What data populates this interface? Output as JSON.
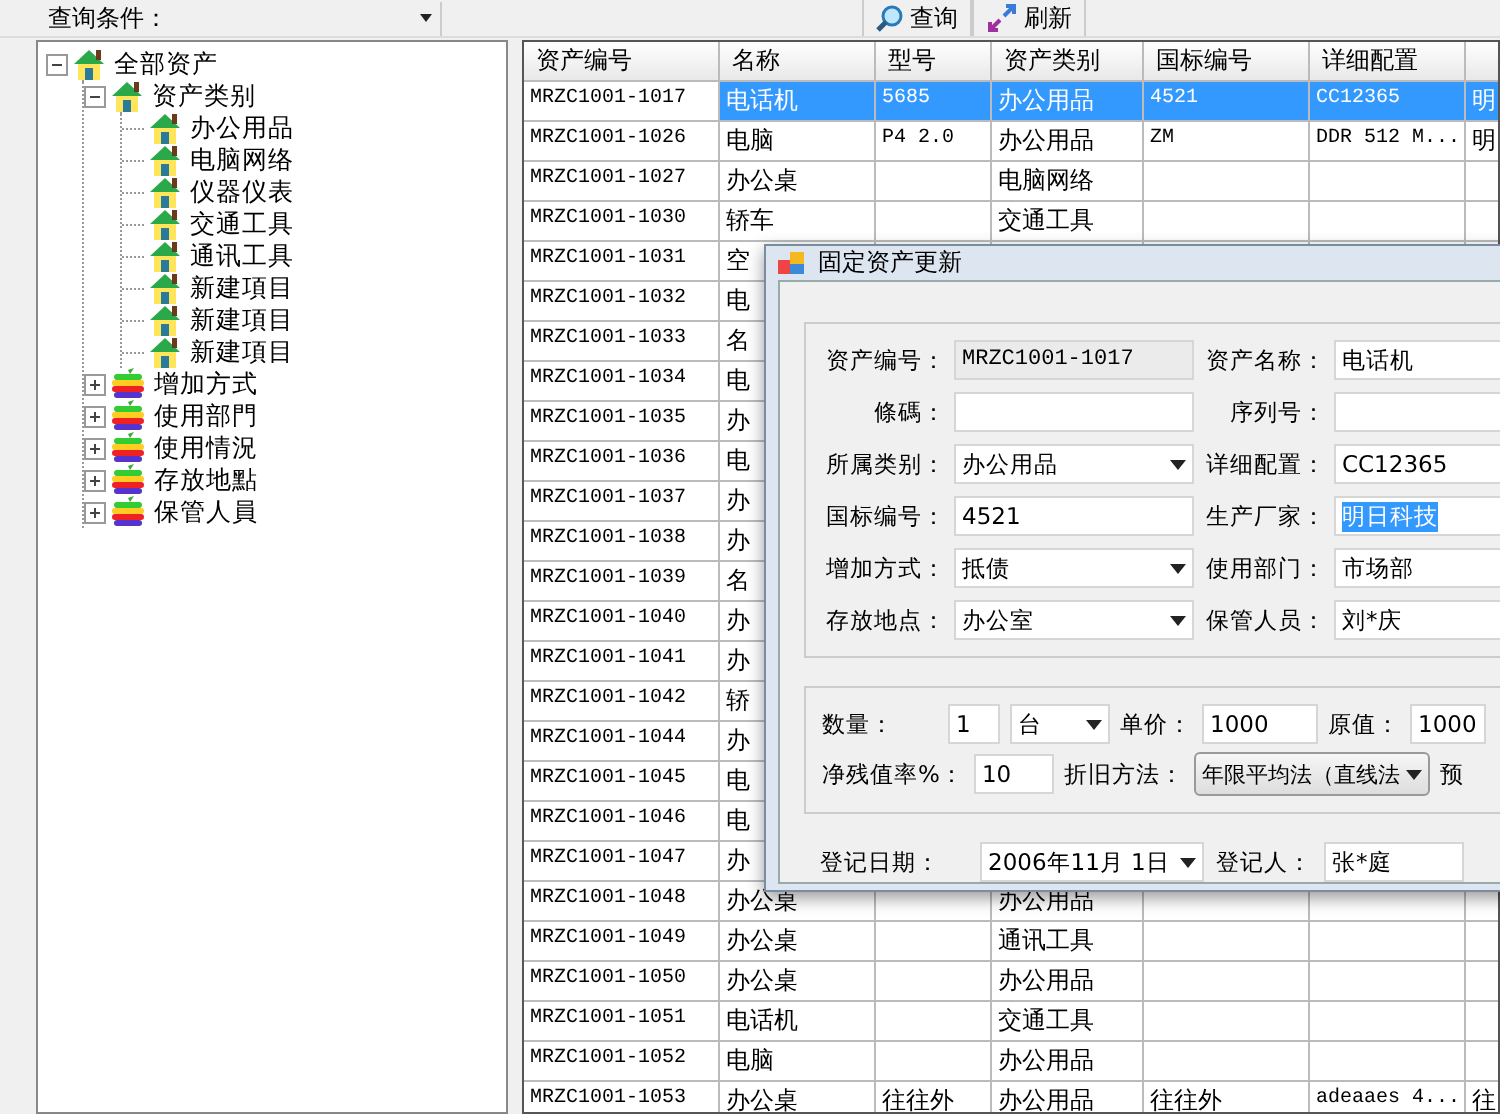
{
  "toolbar": {
    "query_label": "查询条件：",
    "buttons": [
      {
        "kind": "search",
        "label": "查询"
      },
      {
        "kind": "refresh",
        "label": "刷新"
      }
    ]
  },
  "tree": [
    {
      "label": "全部资产",
      "kind": "house",
      "expanded": true,
      "children": [
        {
          "label": "资产类别",
          "kind": "house",
          "expanded": true,
          "children": [
            {
              "label": "办公用品",
              "kind": "house"
            },
            {
              "label": "电脑网络",
              "kind": "house"
            },
            {
              "label": "仪器仪表",
              "kind": "house"
            },
            {
              "label": "交通工具",
              "kind": "house"
            },
            {
              "label": "通讯工具",
              "kind": "house"
            },
            {
              "label": "新建項目",
              "kind": "house"
            },
            {
              "label": "新建項目",
              "kind": "house"
            },
            {
              "label": "新建項目",
              "kind": "house"
            }
          ]
        },
        {
          "label": "增加方式",
          "kind": "stack",
          "expanded": false
        },
        {
          "label": "使用部門",
          "kind": "stack",
          "expanded": false
        },
        {
          "label": "使用情況",
          "kind": "stack",
          "expanded": false
        },
        {
          "label": "存放地點",
          "kind": "stack",
          "expanded": false
        },
        {
          "label": "保管人員",
          "kind": "stack",
          "expanded": false
        }
      ]
    }
  ],
  "table": {
    "columns": [
      "资产编号",
      "名称",
      "型号",
      "资产类别",
      "国标编号",
      "详细配置"
    ],
    "rows": [
      {
        "selected": true,
        "cells": [
          "MRZC1001-1017",
          "电话机",
          "5685",
          "办公用品",
          "4521",
          "CC12365",
          "明"
        ]
      },
      {
        "selected": false,
        "cells": [
          "MRZC1001-1026",
          "电脑",
          "P4 2.0",
          "办公用品",
          "ZM",
          "DDR 512 M...",
          "明"
        ]
      },
      {
        "selected": false,
        "cells": [
          "MRZC1001-1027",
          "办公桌",
          null,
          "电脑网络"
        ]
      },
      {
        "selected": false,
        "cells": [
          "MRZC1001-1030",
          "轿车",
          null,
          "交通工具"
        ]
      },
      {
        "selected": false,
        "cells": [
          "MRZC1001-1031",
          "空"
        ]
      },
      {
        "selected": false,
        "cells": [
          "MRZC1001-1032",
          "电"
        ]
      },
      {
        "selected": false,
        "cells": [
          "MRZC1001-1033",
          "名"
        ]
      },
      {
        "selected": false,
        "cells": [
          "MRZC1001-1034",
          "电"
        ]
      },
      {
        "selected": false,
        "cells": [
          "MRZC1001-1035",
          "办"
        ]
      },
      {
        "selected": false,
        "cells": [
          "MRZC1001-1036",
          "电"
        ]
      },
      {
        "selected": false,
        "cells": [
          "MRZC1001-1037",
          "办"
        ]
      },
      {
        "selected": false,
        "cells": [
          "MRZC1001-1038",
          "办"
        ]
      },
      {
        "selected": false,
        "cells": [
          "MRZC1001-1039",
          "名"
        ]
      },
      {
        "selected": false,
        "cells": [
          "MRZC1001-1040",
          "办"
        ]
      },
      {
        "selected": false,
        "cells": [
          "MRZC1001-1041",
          "办"
        ]
      },
      {
        "selected": false,
        "cells": [
          "MRZC1001-1042",
          "轿"
        ]
      },
      {
        "selected": false,
        "cells": [
          "MRZC1001-1044",
          "办"
        ]
      },
      {
        "selected": false,
        "cells": [
          "MRZC1001-1045",
          "电"
        ]
      },
      {
        "selected": false,
        "cells": [
          "MRZC1001-1046",
          "电"
        ]
      },
      {
        "selected": false,
        "cells": [
          "MRZC1001-1047",
          "办"
        ]
      },
      {
        "selected": false,
        "cells": [
          "MRZC1001-1048",
          "办公桌",
          null,
          "办公用品"
        ]
      },
      {
        "selected": false,
        "cells": [
          "MRZC1001-1049",
          "办公桌",
          null,
          "通讯工具"
        ]
      },
      {
        "selected": false,
        "cells": [
          "MRZC1001-1050",
          "办公桌",
          null,
          "办公用品"
        ]
      },
      {
        "selected": false,
        "cells": [
          "MRZC1001-1051",
          "电话机",
          null,
          "交通工具"
        ]
      },
      {
        "selected": false,
        "cells": [
          "MRZC1001-1052",
          "电脑",
          null,
          "办公用品"
        ]
      },
      {
        "selected": false,
        "cells": [
          "MRZC1001-1053",
          "办公桌",
          "往往外",
          "办公用品",
          "往往外",
          "adeaaes 4...",
          "往"
        ]
      }
    ]
  },
  "dialog": {
    "title": "固定资产更新",
    "fields": [
      {
        "label": "资产编号：",
        "kind": "readonly",
        "value": "MRZC1001-1017"
      },
      {
        "label": "资产名称：",
        "kind": "text",
        "value": "电话机"
      },
      {
        "label": "條碼：",
        "kind": "text"
      },
      {
        "label": "序列号：",
        "kind": "text"
      },
      {
        "label": "所属类别：",
        "kind": "dropdown",
        "value": "办公用品"
      },
      {
        "label": "详细配置：",
        "kind": "text",
        "value": "CC12365"
      },
      {
        "label": "国标编号：",
        "kind": "text",
        "value": "4521"
      },
      {
        "label": "生产厂家：",
        "kind": "highlighted",
        "value": "明日科技"
      },
      {
        "label": "增加方式：",
        "kind": "dropdown",
        "value": "抵债"
      },
      {
        "label": "使用部门：",
        "kind": "text",
        "value": "市场部"
      },
      {
        "label": "存放地点：",
        "kind": "dropdown",
        "value": "办公室"
      },
      {
        "label": "保管人员：",
        "kind": "text",
        "value": "刘*庆"
      }
    ],
    "quantity": {
      "label": "数量：",
      "value": "1",
      "unit": "台"
    },
    "unit_price": {
      "label": "单价：",
      "value": "1000"
    },
    "original_value": {
      "label": "原值：",
      "value": "1000"
    },
    "residual_rate": {
      "label": "净残值率%：",
      "value": "10"
    },
    "depreciation": {
      "label": "折旧方法：",
      "value": "年限平均法（直线法"
    },
    "cut_label": "预",
    "register_date": {
      "label": "登记日期：",
      "value": "2006年11月 1日"
    },
    "registrar": {
      "label": "登记人：",
      "value": "张*庭"
    }
  }
}
